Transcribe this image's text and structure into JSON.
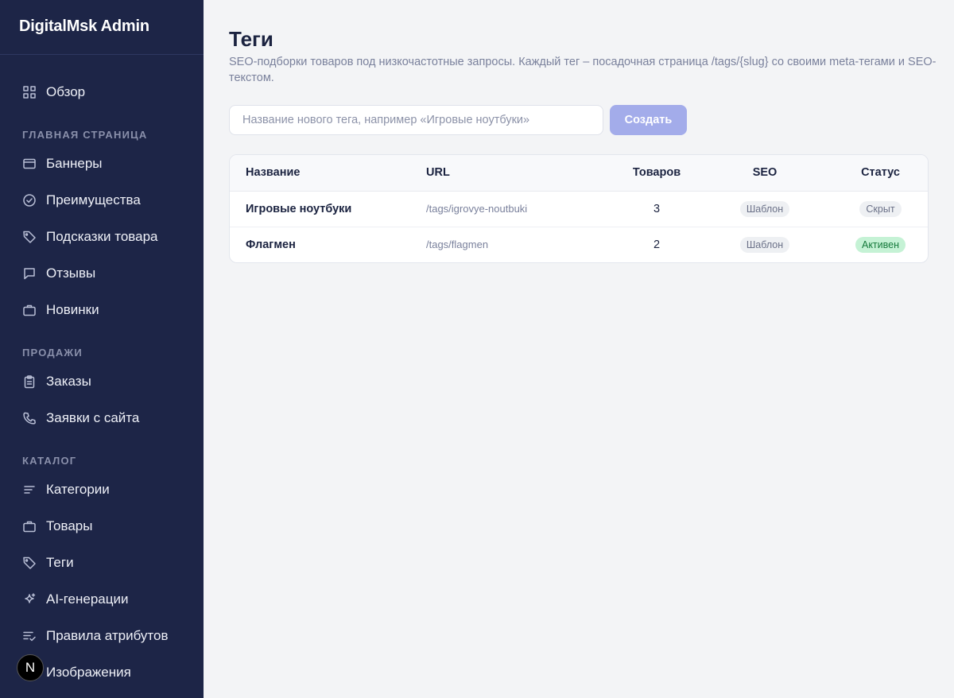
{
  "app": {
    "title": "DigitalMsk Admin"
  },
  "sidebar": {
    "overview": {
      "label": "Обзор",
      "icon": "grid-icon"
    },
    "sections": {
      "home": "ГЛАВНАЯ СТРАНИЦА",
      "sales": "ПРОДАЖИ",
      "catalog": "КАТАЛОГ"
    },
    "items": [
      {
        "label": "Баннеры",
        "icon": "card-icon"
      },
      {
        "label": "Преимущества",
        "icon": "check-circle-icon"
      },
      {
        "label": "Подсказки товара",
        "icon": "tag-icon"
      },
      {
        "label": "Отзывы",
        "icon": "chat-icon"
      },
      {
        "label": "Новинки",
        "icon": "briefcase-icon"
      },
      {
        "label": "Заказы",
        "icon": "clipboard-icon"
      },
      {
        "label": "Заявки с сайта",
        "icon": "phone-icon"
      },
      {
        "label": "Категории",
        "icon": "lines-icon"
      },
      {
        "label": "Товары",
        "icon": "briefcase-icon"
      },
      {
        "label": "Теги",
        "icon": "tag-icon"
      },
      {
        "label": "AI-генерации",
        "icon": "sparkle-icon"
      },
      {
        "label": "Правила атрибутов",
        "icon": "list-check-icon"
      },
      {
        "label": "Изображения",
        "icon": "image-icon"
      }
    ],
    "next_badge": "N"
  },
  "page": {
    "title": "Теги",
    "description": "SEO-подборки товаров под низкочастотные запросы. Каждый тег – посадочная страница /tags/{slug} со своими meta-тегами и SEO-текстом.",
    "new_tag_placeholder": "Название нового тега, например «Игровые ноутбуки»",
    "create_label": "Создать"
  },
  "table": {
    "headers": {
      "name": "Название",
      "url": "URL",
      "count": "Товаров",
      "seo": "SEO",
      "status": "Статус"
    },
    "rows": [
      {
        "name": "Игровые ноутбуки",
        "url": "/tags/igrovye-noutbuki",
        "count": "3",
        "seo": "Шаблон",
        "status": "Скрыт"
      },
      {
        "name": "Флагмен",
        "url": "/tags/flagmen",
        "count": "2",
        "seo": "Шаблон",
        "status": "Активен"
      }
    ]
  },
  "colors": {
    "sidebar_bg": "#1d2547",
    "accent_button": "#a3acea",
    "status_active_bg": "#c5f2d5",
    "status_active_text": "#167a3c"
  }
}
